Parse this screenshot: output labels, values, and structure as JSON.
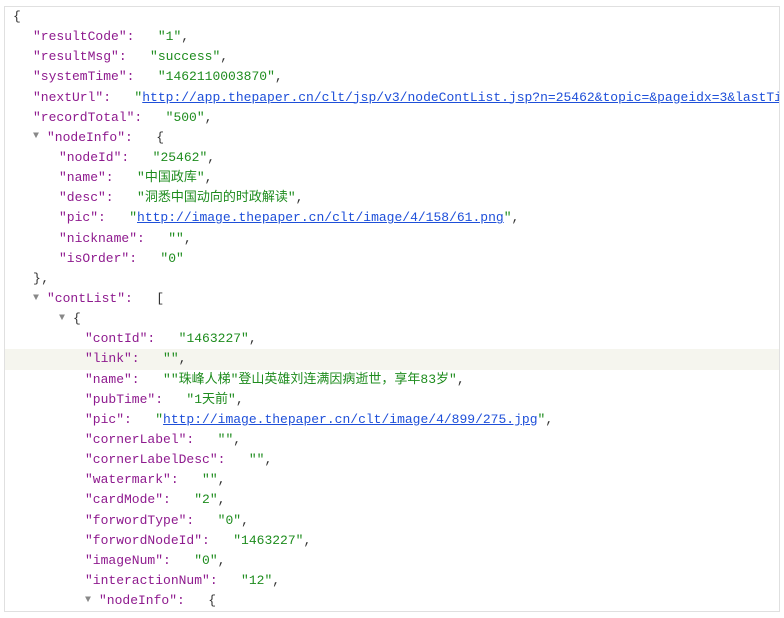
{
  "glyphs": {
    "collapse": "▼"
  },
  "root": {
    "open": "{",
    "resultCode": {
      "key": "\"resultCode\":",
      "q": "\"",
      "val": "1",
      "sep": ","
    },
    "resultMsg": {
      "key": "\"resultMsg\":",
      "q": "\"",
      "val": "success",
      "sep": ","
    },
    "systemTime": {
      "key": "\"systemTime\":",
      "q": "\"",
      "val": "1462110003870",
      "sep": ","
    },
    "nextUrl": {
      "key": "\"nextUrl\":",
      "q": "\"",
      "val": "http://app.thepaper.cn/clt/jsp/v3/nodeContList.jsp?n=25462&topic=&pageidx=3&lastTime=1461908704221",
      "sep": ","
    },
    "recordTotal": {
      "key": "\"recordTotal\":",
      "q": "\"",
      "val": "500",
      "sep": ","
    },
    "nodeInfo": {
      "key": "\"nodeInfo\":",
      "open": "{",
      "nodeId": {
        "key": "\"nodeId\":",
        "q": "\"",
        "val": "25462",
        "sep": ","
      },
      "name": {
        "key": "\"name\":",
        "q": "\"",
        "val": "中国政库",
        "sep": ","
      },
      "desc": {
        "key": "\"desc\":",
        "q": "\"",
        "val": "洞悉中国动向的时政解读",
        "sep": ","
      },
      "pic": {
        "key": "\"pic\":",
        "q": "\"",
        "val": "http://image.thepaper.cn/clt/image/4/158/61.png",
        "sep": ","
      },
      "nickname": {
        "key": "\"nickname\":",
        "q": "\"",
        "val": "",
        "sep": ","
      },
      "isOrder": {
        "key": "\"isOrder\":",
        "q": "\"",
        "val": "0",
        "sep": ""
      },
      "close": "},"
    },
    "contList": {
      "key": "\"contList\":",
      "open": "[",
      "item0": {
        "open": "{",
        "contId": {
          "key": "\"contId\":",
          "q": "\"",
          "val": "1463227",
          "sep": ","
        },
        "link_": {
          "key": "\"link\":",
          "q": "\"",
          "val": "",
          "sep": ","
        },
        "name": {
          "key": "\"name\":",
          "q": "\"",
          "val": "\"珠峰人梯\"登山英雄刘连满因病逝世，享年83岁",
          "sep": ","
        },
        "pubTime": {
          "key": "\"pubTime\":",
          "q": "\"",
          "val": "1天前",
          "sep": ","
        },
        "pic": {
          "key": "\"pic\":",
          "q": "\"",
          "val": "http://image.thepaper.cn/clt/image/4/899/275.jpg",
          "sep": ","
        },
        "cornerLabel": {
          "key": "\"cornerLabel\":",
          "q": "\"",
          "val": "",
          "sep": ","
        },
        "cornerLabelDesc": {
          "key": "\"cornerLabelDesc\":",
          "q": "\"",
          "val": "",
          "sep": ","
        },
        "watermark": {
          "key": "\"watermark\":",
          "q": "\"",
          "val": "",
          "sep": ","
        },
        "cardMode": {
          "key": "\"cardMode\":",
          "q": "\"",
          "val": "2",
          "sep": ","
        },
        "forwordType": {
          "key": "\"forwordType\":",
          "q": "\"",
          "val": "0",
          "sep": ","
        },
        "forwordNodeId": {
          "key": "\"forwordNodeId\":",
          "q": "\"",
          "val": "1463227",
          "sep": ","
        },
        "imageNum": {
          "key": "\"imageNum\":",
          "q": "\"",
          "val": "0",
          "sep": ","
        },
        "interactionNum": {
          "key": "\"interactionNum\":",
          "q": "\"",
          "val": "12",
          "sep": ","
        },
        "nodeInfo": {
          "key": "\"nodeInfo\":",
          "open": "{"
        }
      }
    }
  }
}
